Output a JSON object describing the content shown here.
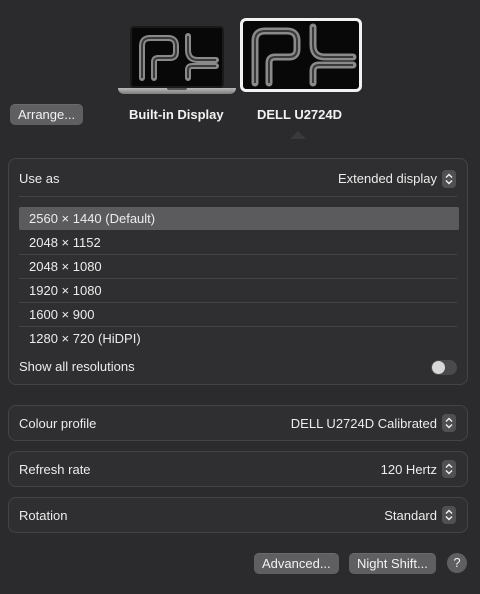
{
  "displays": {
    "arrange_label": "Arrange...",
    "builtin_label": "Built-in Display",
    "external_label": "DELL U2724D",
    "selected": "DELL U2724D"
  },
  "use_as": {
    "label": "Use as",
    "value": "Extended display"
  },
  "resolutions": {
    "items": [
      "2560 × 1440 (Default)",
      "2048 × 1152",
      "2048 × 1080",
      "1920 × 1080",
      "1600 × 900",
      "1280 × 720 (HiDPI)"
    ],
    "selected_index": 0,
    "show_all_label": "Show all resolutions",
    "show_all_enabled": false
  },
  "colour_profile": {
    "label": "Colour profile",
    "value": "DELL U2724D Calibrated"
  },
  "refresh_rate": {
    "label": "Refresh rate",
    "value": "120 Hertz"
  },
  "rotation": {
    "label": "Rotation",
    "value": "Standard"
  },
  "footer": {
    "advanced_label": "Advanced...",
    "night_shift_label": "Night Shift...",
    "help_label": "?"
  },
  "colors": {
    "window_bg": "#2b2b2d",
    "panel_bg": "#2f2f31",
    "selected_row": "#5b5b5e",
    "button_bg": "#5f5f62"
  }
}
